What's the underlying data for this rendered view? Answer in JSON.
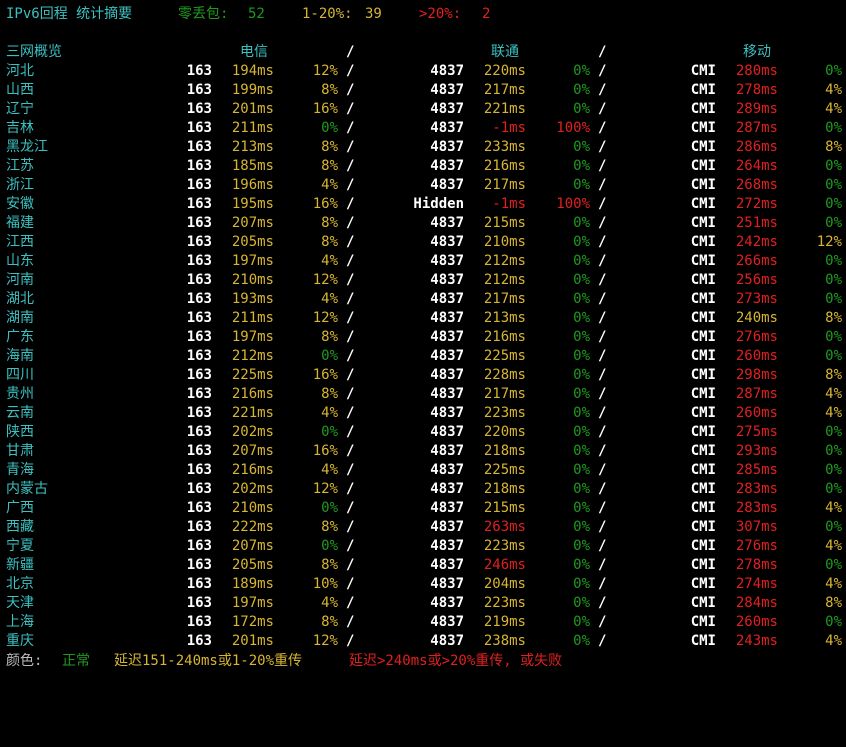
{
  "summary": {
    "title": "IPv6回程 统计摘要",
    "zero_loss_label": "零丢包:",
    "zero_loss_value": "52",
    "loss_1_20_label": "1-20%:",
    "loss_1_20_value": "39",
    "loss_over20_label": ">20%:",
    "loss_over20_value": "2"
  },
  "header": {
    "region": "三网概览",
    "telecom": "电信",
    "unicom": "联通",
    "mobile": "移动",
    "sep": "/"
  },
  "rows": [
    {
      "region": "河北",
      "t_as": "163",
      "t_lat": "194ms",
      "t_loss": "12%",
      "u_as": "4837",
      "u_lat": "220ms",
      "u_loss": "0%",
      "m_as": "CMI",
      "m_lat": "280ms",
      "m_loss": "0%"
    },
    {
      "region": "山西",
      "t_as": "163",
      "t_lat": "199ms",
      "t_loss": "8%",
      "u_as": "4837",
      "u_lat": "217ms",
      "u_loss": "0%",
      "m_as": "CMI",
      "m_lat": "278ms",
      "m_loss": "4%"
    },
    {
      "region": "辽宁",
      "t_as": "163",
      "t_lat": "201ms",
      "t_loss": "16%",
      "u_as": "4837",
      "u_lat": "221ms",
      "u_loss": "0%",
      "m_as": "CMI",
      "m_lat": "289ms",
      "m_loss": "4%"
    },
    {
      "region": "吉林",
      "t_as": "163",
      "t_lat": "211ms",
      "t_loss": "0%",
      "u_as": "4837",
      "u_lat": "-1ms",
      "u_loss": "100%",
      "m_as": "CMI",
      "m_lat": "287ms",
      "m_loss": "0%"
    },
    {
      "region": "黑龙江",
      "t_as": "163",
      "t_lat": "213ms",
      "t_loss": "8%",
      "u_as": "4837",
      "u_lat": "233ms",
      "u_loss": "0%",
      "m_as": "CMI",
      "m_lat": "286ms",
      "m_loss": "8%"
    },
    {
      "region": "江苏",
      "t_as": "163",
      "t_lat": "185ms",
      "t_loss": "8%",
      "u_as": "4837",
      "u_lat": "216ms",
      "u_loss": "0%",
      "m_as": "CMI",
      "m_lat": "264ms",
      "m_loss": "0%"
    },
    {
      "region": "浙江",
      "t_as": "163",
      "t_lat": "196ms",
      "t_loss": "4%",
      "u_as": "4837",
      "u_lat": "217ms",
      "u_loss": "0%",
      "m_as": "CMI",
      "m_lat": "268ms",
      "m_loss": "0%"
    },
    {
      "region": "安徽",
      "t_as": "163",
      "t_lat": "195ms",
      "t_loss": "16%",
      "u_as": "Hidden",
      "u_lat": "-1ms",
      "u_loss": "100%",
      "m_as": "CMI",
      "m_lat": "272ms",
      "m_loss": "0%"
    },
    {
      "region": "福建",
      "t_as": "163",
      "t_lat": "207ms",
      "t_loss": "8%",
      "u_as": "4837",
      "u_lat": "215ms",
      "u_loss": "0%",
      "m_as": "CMI",
      "m_lat": "251ms",
      "m_loss": "0%"
    },
    {
      "region": "江西",
      "t_as": "163",
      "t_lat": "205ms",
      "t_loss": "8%",
      "u_as": "4837",
      "u_lat": "210ms",
      "u_loss": "0%",
      "m_as": "CMI",
      "m_lat": "242ms",
      "m_loss": "12%"
    },
    {
      "region": "山东",
      "t_as": "163",
      "t_lat": "197ms",
      "t_loss": "4%",
      "u_as": "4837",
      "u_lat": "212ms",
      "u_loss": "0%",
      "m_as": "CMI",
      "m_lat": "266ms",
      "m_loss": "0%"
    },
    {
      "region": "河南",
      "t_as": "163",
      "t_lat": "210ms",
      "t_loss": "12%",
      "u_as": "4837",
      "u_lat": "212ms",
      "u_loss": "0%",
      "m_as": "CMI",
      "m_lat": "256ms",
      "m_loss": "0%"
    },
    {
      "region": "湖北",
      "t_as": "163",
      "t_lat": "193ms",
      "t_loss": "4%",
      "u_as": "4837",
      "u_lat": "217ms",
      "u_loss": "0%",
      "m_as": "CMI",
      "m_lat": "273ms",
      "m_loss": "0%"
    },
    {
      "region": "湖南",
      "t_as": "163",
      "t_lat": "211ms",
      "t_loss": "12%",
      "u_as": "4837",
      "u_lat": "213ms",
      "u_loss": "0%",
      "m_as": "CMI",
      "m_lat": "240ms",
      "m_loss": "8%"
    },
    {
      "region": "广东",
      "t_as": "163",
      "t_lat": "197ms",
      "t_loss": "8%",
      "u_as": "4837",
      "u_lat": "216ms",
      "u_loss": "0%",
      "m_as": "CMI",
      "m_lat": "276ms",
      "m_loss": "0%"
    },
    {
      "region": "海南",
      "t_as": "163",
      "t_lat": "212ms",
      "t_loss": "0%",
      "u_as": "4837",
      "u_lat": "225ms",
      "u_loss": "0%",
      "m_as": "CMI",
      "m_lat": "260ms",
      "m_loss": "0%"
    },
    {
      "region": "四川",
      "t_as": "163",
      "t_lat": "225ms",
      "t_loss": "16%",
      "u_as": "4837",
      "u_lat": "228ms",
      "u_loss": "0%",
      "m_as": "CMI",
      "m_lat": "298ms",
      "m_loss": "8%"
    },
    {
      "region": "贵州",
      "t_as": "163",
      "t_lat": "216ms",
      "t_loss": "8%",
      "u_as": "4837",
      "u_lat": "217ms",
      "u_loss": "0%",
      "m_as": "CMI",
      "m_lat": "287ms",
      "m_loss": "4%"
    },
    {
      "region": "云南",
      "t_as": "163",
      "t_lat": "221ms",
      "t_loss": "4%",
      "u_as": "4837",
      "u_lat": "223ms",
      "u_loss": "0%",
      "m_as": "CMI",
      "m_lat": "260ms",
      "m_loss": "4%"
    },
    {
      "region": "陕西",
      "t_as": "163",
      "t_lat": "202ms",
      "t_loss": "0%",
      "u_as": "4837",
      "u_lat": "220ms",
      "u_loss": "0%",
      "m_as": "CMI",
      "m_lat": "275ms",
      "m_loss": "0%"
    },
    {
      "region": "甘肃",
      "t_as": "163",
      "t_lat": "207ms",
      "t_loss": "16%",
      "u_as": "4837",
      "u_lat": "218ms",
      "u_loss": "0%",
      "m_as": "CMI",
      "m_lat": "293ms",
      "m_loss": "0%"
    },
    {
      "region": "青海",
      "t_as": "163",
      "t_lat": "216ms",
      "t_loss": "4%",
      "u_as": "4837",
      "u_lat": "225ms",
      "u_loss": "0%",
      "m_as": "CMI",
      "m_lat": "285ms",
      "m_loss": "0%"
    },
    {
      "region": "内蒙古",
      "t_as": "163",
      "t_lat": "202ms",
      "t_loss": "12%",
      "u_as": "4837",
      "u_lat": "218ms",
      "u_loss": "0%",
      "m_as": "CMI",
      "m_lat": "283ms",
      "m_loss": "0%"
    },
    {
      "region": "广西",
      "t_as": "163",
      "t_lat": "210ms",
      "t_loss": "0%",
      "u_as": "4837",
      "u_lat": "215ms",
      "u_loss": "0%",
      "m_as": "CMI",
      "m_lat": "283ms",
      "m_loss": "4%"
    },
    {
      "region": "西藏",
      "t_as": "163",
      "t_lat": "222ms",
      "t_loss": "8%",
      "u_as": "4837",
      "u_lat": "263ms",
      "u_loss": "0%",
      "m_as": "CMI",
      "m_lat": "307ms",
      "m_loss": "0%"
    },
    {
      "region": "宁夏",
      "t_as": "163",
      "t_lat": "207ms",
      "t_loss": "0%",
      "u_as": "4837",
      "u_lat": "223ms",
      "u_loss": "0%",
      "m_as": "CMI",
      "m_lat": "276ms",
      "m_loss": "4%"
    },
    {
      "region": "新疆",
      "t_as": "163",
      "t_lat": "205ms",
      "t_loss": "8%",
      "u_as": "4837",
      "u_lat": "246ms",
      "u_loss": "0%",
      "m_as": "CMI",
      "m_lat": "278ms",
      "m_loss": "0%"
    },
    {
      "region": "北京",
      "t_as": "163",
      "t_lat": "189ms",
      "t_loss": "10%",
      "u_as": "4837",
      "u_lat": "204ms",
      "u_loss": "0%",
      "m_as": "CMI",
      "m_lat": "274ms",
      "m_loss": "4%"
    },
    {
      "region": "天津",
      "t_as": "163",
      "t_lat": "197ms",
      "t_loss": "4%",
      "u_as": "4837",
      "u_lat": "223ms",
      "u_loss": "0%",
      "m_as": "CMI",
      "m_lat": "284ms",
      "m_loss": "8%"
    },
    {
      "region": "上海",
      "t_as": "163",
      "t_lat": "172ms",
      "t_loss": "8%",
      "u_as": "4837",
      "u_lat": "219ms",
      "u_loss": "0%",
      "m_as": "CMI",
      "m_lat": "260ms",
      "m_loss": "0%"
    },
    {
      "region": "重庆",
      "t_as": "163",
      "t_lat": "201ms",
      "t_loss": "12%",
      "u_as": "4837",
      "u_lat": "238ms",
      "u_loss": "0%",
      "m_as": "CMI",
      "m_lat": "243ms",
      "m_loss": "4%"
    }
  ],
  "legend": {
    "label": "颜色:",
    "normal": "正常",
    "warn": "延迟151-240ms或1-20%重传",
    "bad": "延迟>240ms或>20%重传, 或失败"
  },
  "colors": {
    "green": "#4ec64e",
    "yellow": "#d7b533",
    "red": "#e02020",
    "cyan": "#3cc0c0",
    "white": "#ffffff",
    "background": "#000000"
  }
}
